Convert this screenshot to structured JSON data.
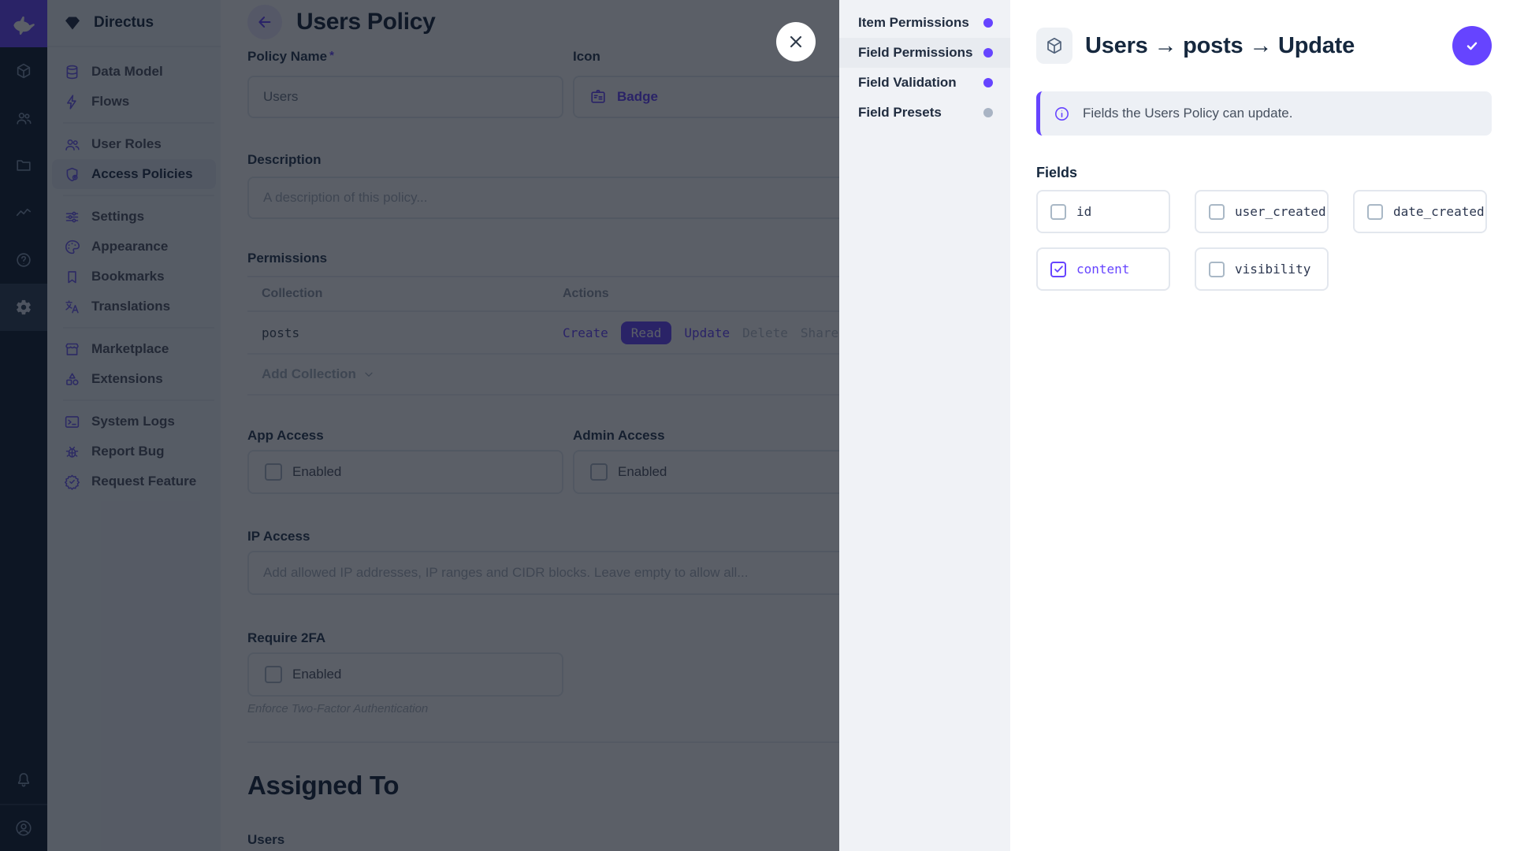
{
  "accent_color": "#6644ff",
  "module_bar": {
    "logo_icon": "directus-rabbit-icon",
    "modules": [
      {
        "icon": "cube-icon",
        "name": "content",
        "active": false
      },
      {
        "icon": "users-icon",
        "name": "user-directory",
        "active": false
      },
      {
        "icon": "folder-icon",
        "name": "file-library",
        "active": false
      },
      {
        "icon": "activity-icon",
        "name": "insights",
        "active": false
      },
      {
        "icon": "help-icon",
        "name": "documentation",
        "active": false
      },
      {
        "icon": "gear-icon",
        "name": "settings",
        "active": true
      }
    ],
    "bottom": [
      {
        "icon": "bell-icon",
        "name": "notifications"
      },
      {
        "icon": "avatar-icon",
        "name": "user-menu"
      }
    ]
  },
  "nav": {
    "project_name": "Directus",
    "project_icon": "gem-icon",
    "groups": [
      {
        "items": [
          {
            "label": "Data Model",
            "icon": "database-icon",
            "active": false
          },
          {
            "label": "Flows",
            "icon": "bolt-icon",
            "active": false
          }
        ]
      },
      {
        "items": [
          {
            "label": "User Roles",
            "icon": "user-group-icon",
            "active": false
          },
          {
            "label": "Access Policies",
            "icon": "shield-lock-icon",
            "active": true
          }
        ]
      },
      {
        "items": [
          {
            "label": "Settings",
            "icon": "tune-icon",
            "active": false
          },
          {
            "label": "Appearance",
            "icon": "palette-icon",
            "active": false
          },
          {
            "label": "Bookmarks",
            "icon": "bookmark-icon",
            "active": false
          },
          {
            "label": "Translations",
            "icon": "translate-icon",
            "active": false
          }
        ]
      },
      {
        "items": [
          {
            "label": "Marketplace",
            "icon": "storefront-icon",
            "active": false
          },
          {
            "label": "Extensions",
            "icon": "extensions-icon",
            "active": false
          }
        ]
      },
      {
        "items": [
          {
            "label": "System Logs",
            "icon": "terminal-icon",
            "active": false
          },
          {
            "label": "Report Bug",
            "icon": "bug-icon",
            "active": false
          },
          {
            "label": "Request Feature",
            "icon": "feature-icon",
            "active": false
          }
        ]
      }
    ]
  },
  "main": {
    "title": "Users Policy",
    "back_icon": "arrow-left-icon",
    "form": {
      "policy_name": {
        "label": "Policy Name",
        "required_marker": "*",
        "value": "Users"
      },
      "icon_field": {
        "label": "Icon",
        "value": "Badge",
        "icon": "badge-icon"
      },
      "description": {
        "label": "Description",
        "placeholder": "A description of this policy..."
      }
    },
    "permissions": {
      "section_label": "Permissions",
      "columns": {
        "collection": "Collection",
        "actions": "Actions"
      },
      "rows": [
        {
          "collection": "posts",
          "actions": [
            {
              "label": "Create",
              "state": "enabled"
            },
            {
              "label": "Read",
              "state": "active"
            },
            {
              "label": "Update",
              "state": "enabled"
            },
            {
              "label": "Delete",
              "state": "disabled"
            },
            {
              "label": "Share",
              "state": "disabled"
            }
          ]
        }
      ],
      "add_collection_label": "Add Collection"
    },
    "app_access": {
      "label": "App Access",
      "checkbox_label": "Enabled",
      "checked": false
    },
    "admin_access": {
      "label": "Admin Access",
      "checkbox_label": "Enabled",
      "checked": false
    },
    "ip_access": {
      "label": "IP Access",
      "placeholder": "Add allowed IP addresses, IP ranges and CIDR blocks. Leave empty to allow all..."
    },
    "require_2fa": {
      "label": "Require 2FA",
      "checkbox_label": "Enabled",
      "checked": false,
      "note": "Enforce Two-Factor Authentication"
    },
    "assigned_to": {
      "heading": "Assigned To",
      "users_label": "Users"
    }
  },
  "drawer": {
    "nav": [
      {
        "label": "Item Permissions",
        "dot_color": "purple",
        "active": false
      },
      {
        "label": "Field Permissions",
        "dot_color": "purple",
        "active": true
      },
      {
        "label": "Field Validation",
        "dot_color": "purple",
        "active": false
      },
      {
        "label": "Field Presets",
        "dot_color": "gray",
        "active": false
      }
    ],
    "header": {
      "icon": "cube-icon",
      "title": "Users → posts → Update",
      "confirm_icon": "check-icon"
    },
    "banner": {
      "icon": "info-icon",
      "text": "Fields the Users Policy can update."
    },
    "fields_label": "Fields",
    "fields": [
      {
        "name": "id",
        "checked": false
      },
      {
        "name": "user_created",
        "checked": false
      },
      {
        "name": "date_created",
        "checked": false
      },
      {
        "name": "content",
        "checked": true
      },
      {
        "name": "visibility",
        "checked": false
      }
    ]
  },
  "close_button_icon": "close-icon"
}
